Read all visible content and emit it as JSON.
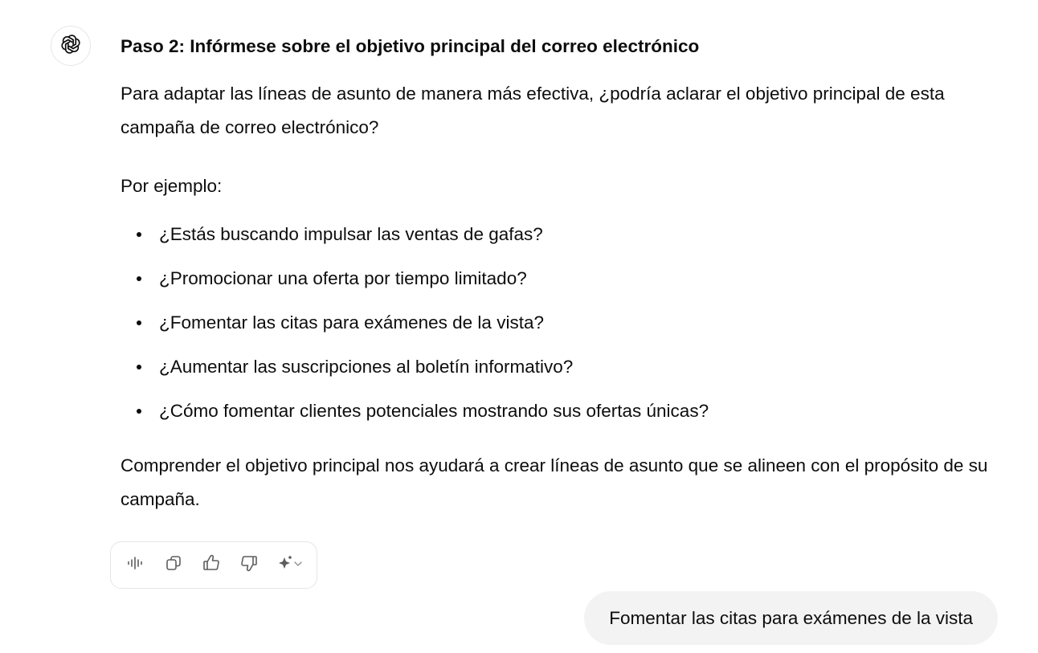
{
  "assistant": {
    "avatar_icon": "openai-logo-icon",
    "heading": "Paso 2: Infórmese sobre el objetivo principal del correo electrónico",
    "intro": "Para adaptar las líneas de asunto de manera más efectiva, ¿podría aclarar el objetivo principal de esta campaña de correo electrónico?",
    "examples_label": "Por ejemplo:",
    "examples": [
      "¿Estás buscando impulsar las ventas de gafas?",
      "¿Promocionar una oferta por tiempo limitado?",
      "¿Fomentar las citas para exámenes de la vista?",
      "¿Aumentar las suscripciones al boletín informativo?",
      "¿Cómo fomentar clientes potenciales mostrando sus ofertas únicas?"
    ],
    "closing": "Comprender el objetivo principal nos ayudará a crear líneas de asunto que se alineen con el propósito de su campaña."
  },
  "toolbar": {
    "icons": [
      "read-aloud-icon",
      "copy-icon",
      "thumbs-up-icon",
      "thumbs-down-icon",
      "sparkle-model-icon"
    ]
  },
  "user_message": {
    "text": "Fomentar las citas para exámenes de la vista"
  },
  "colors": {
    "text": "#0d0d0d",
    "bubble_bg": "#f3f3f3",
    "border": "#e6e6e6",
    "icon": "#5d5d5d"
  }
}
